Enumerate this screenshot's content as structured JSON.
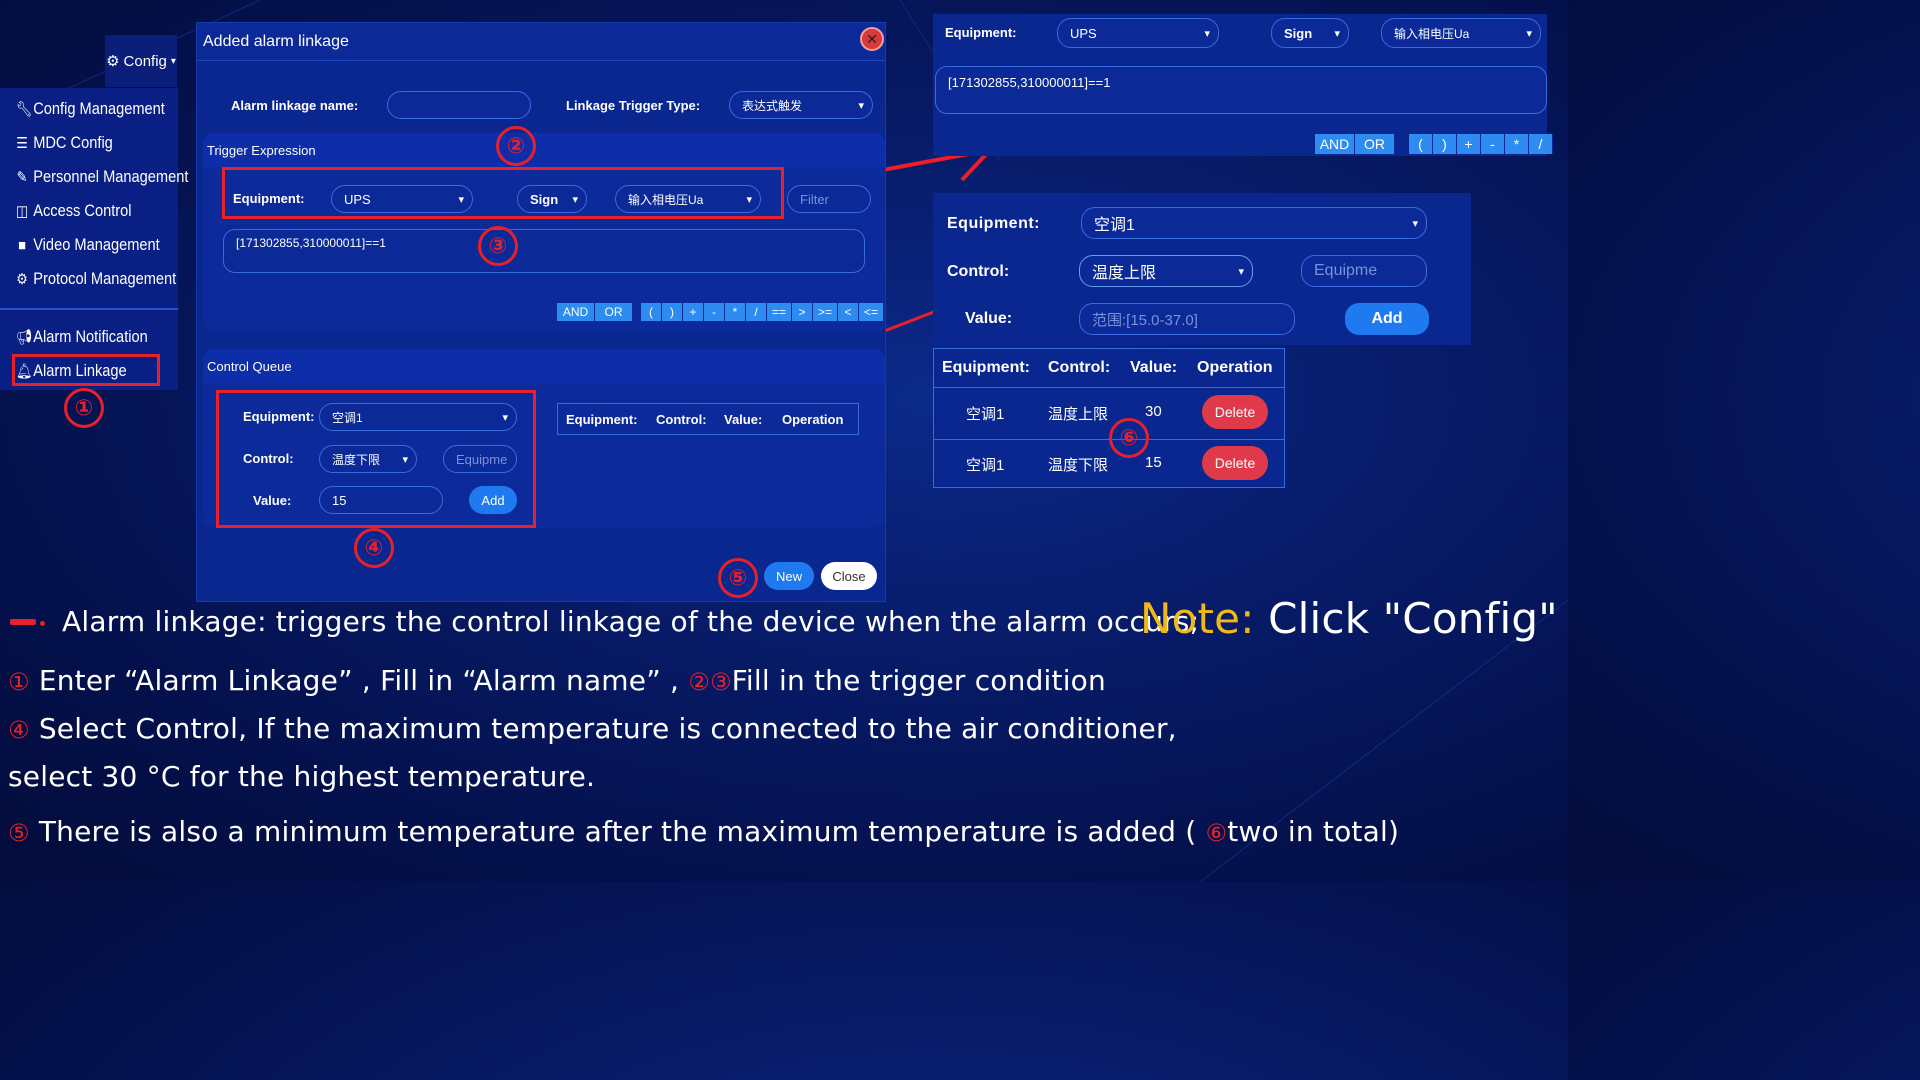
{
  "colors": {
    "background": "#071a66",
    "panel": "#0a2790",
    "accent": "#2e8cf0",
    "delete": "#e03a4a",
    "highlight": "#e8202a",
    "note": "#f0b818"
  },
  "config_menu": {
    "icon": "gear-icon",
    "label": "Config"
  },
  "sidebar": {
    "items": [
      {
        "icon": "wrench-icon",
        "label": "Config Management"
      },
      {
        "icon": "list-icon",
        "label": "MDC Config"
      },
      {
        "icon": "wrench-icon",
        "label": "Personnel Management"
      },
      {
        "icon": "door-icon",
        "label": "Access Control"
      },
      {
        "icon": "video-icon",
        "label": "Video Management"
      },
      {
        "icon": "gears-icon",
        "label": "Protocol Management"
      },
      {
        "icon": "megaphone-icon",
        "label": "Alarm Notification"
      },
      {
        "icon": "bell-icon",
        "label": "Alarm Linkage"
      }
    ]
  },
  "dialog": {
    "title": "Added alarm linkage",
    "close_icon": "close-icon",
    "name_label": "Alarm linkage name:",
    "name_value": "",
    "trigger_type_label": "Linkage Trigger Type:",
    "trigger_type_value": "表达式触发",
    "trigger_expression": {
      "header": "Trigger Expression",
      "equipment_label": "Equipment:",
      "equipment_value": "UPS",
      "sign_value": "Sign",
      "signal_value": "输入相电压Ua",
      "filter_placeholder": "Filter",
      "expression": "[171302855,310000011]==1",
      "operators": [
        "AND",
        "OR",
        "(",
        ")",
        "+",
        "-",
        "*",
        "/",
        "==",
        ">",
        ">=",
        "<",
        "<="
      ]
    },
    "control_queue": {
      "header": "Control Queue",
      "equipment_label": "Equipment:",
      "equipment_value": "空调1",
      "control_label": "Control:",
      "control_value": "温度下限",
      "equip_placeholder": "Equipme",
      "value_label": "Value:",
      "value_value": "15",
      "add_label": "Add",
      "table_headers": [
        "Equipment:",
        "Control:",
        "Value:",
        "Operation"
      ]
    },
    "new_label": "New",
    "close_label": "Close"
  },
  "zoom_trigger": {
    "equipment_label": "Equipment:",
    "equipment_value": "UPS",
    "sign_value": "Sign",
    "signal_value": "输入相电压Ua",
    "expression": "[171302855,310000011]==1",
    "operators": [
      "AND",
      "OR",
      "(",
      ")",
      "+",
      "-",
      "*",
      "/"
    ]
  },
  "zoom_control": {
    "equipment_label": "Equipment:",
    "equipment_value": "空调1",
    "control_label": "Control:",
    "control_value": "温度上限",
    "equip_placeholder": "Equipme",
    "value_label": "Value:",
    "value_placeholder": "范围:[15.0-37.0]",
    "add_label": "Add"
  },
  "zoom_table": {
    "headers": [
      "Equipment:",
      "Control:",
      "Value:",
      "Operation"
    ],
    "rows": [
      {
        "equipment": "空调1",
        "control": "温度上限",
        "value": "30",
        "action": "Delete"
      },
      {
        "equipment": "空调1",
        "control": "温度下限",
        "value": "15",
        "action": "Delete"
      }
    ]
  },
  "markers": [
    "①",
    "②",
    "③",
    "④",
    "⑤",
    "⑥"
  ],
  "notes": {
    "line0": "Alarm linkage: triggers the control linkage of the device when the alarm occurs;",
    "note_label": "Note:",
    "note_text": "Click \"Config\"",
    "line1a": "Enter “Alarm Linkage” , Fill in “Alarm name” ,",
    "line1b": "Fill in the trigger condition",
    "line2": "Select Control, If the maximum temperature is connected to the air conditioner,",
    "line3": "select 30 °C for the highest temperature.",
    "line4a": "There is also a minimum temperature after the maximum temperature is added (",
    "line4b": "two in total)"
  }
}
